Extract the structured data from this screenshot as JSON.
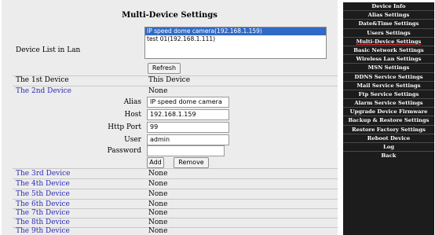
{
  "title": "Multi-Device Settings",
  "device_list_label": "Device List in Lan",
  "device_list": [
    {
      "text": "IP speed dome camera(192.168.1.159)",
      "selected": true
    },
    {
      "text": "test 01(192.168.1.111)",
      "selected": false
    }
  ],
  "refresh_label": "Refresh",
  "first_device": {
    "label": "The 1st Device",
    "value": "This Device"
  },
  "second_device": {
    "label": "The 2nd Device",
    "value": "None"
  },
  "form": {
    "alias_label": "Alias",
    "alias_value": "IP speed dome camera",
    "host_label": "Host",
    "host_value": "192.168.1.159",
    "port_label": "Http Port",
    "port_value": "99",
    "user_label": "User",
    "user_value": "admin",
    "password_label": "Password",
    "password_value": ""
  },
  "add_label": "Add",
  "remove_label": "Remove",
  "other_devices": [
    {
      "label": "The 3rd Device",
      "value": "None"
    },
    {
      "label": "The 4th Device",
      "value": "None"
    },
    {
      "label": "The 5th Device",
      "value": "None"
    },
    {
      "label": "The 6th Device",
      "value": "None"
    },
    {
      "label": "The 7th Device",
      "value": "None"
    },
    {
      "label": "The 8th Device",
      "value": "None"
    },
    {
      "label": "The 9th Device",
      "value": "None"
    }
  ],
  "menu": [
    "Device Info",
    "Alias Settings",
    "Date&Time Settings",
    "Users Settings",
    "Multi-Device Settings",
    "Basic Network Settings",
    "Wireless Lan Settings",
    "MSN Settings",
    "DDNS Service Settings",
    "Mail Service Settings",
    "Ftp Service Settings",
    "Alarm Service Settings",
    "Upgrade Device Firmware",
    "Backup & Restore Settings",
    "Restore Factory Settings",
    "Reboot Device",
    "Log",
    "Back"
  ],
  "active_menu": "Multi-Device Settings"
}
